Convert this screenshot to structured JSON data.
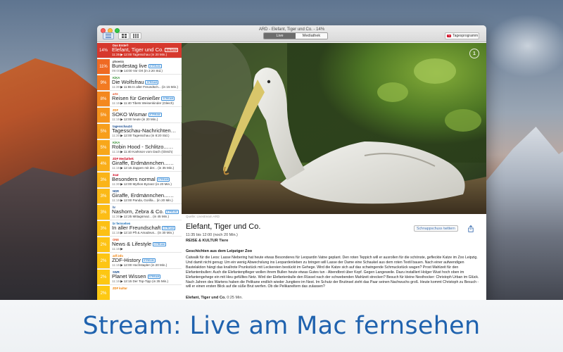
{
  "window": {
    "title": "ARD - Elefant, Tiger und Co. - 14%"
  },
  "toolbar": {
    "segments": [
      "Live",
      "Mediathek"
    ],
    "active_segment": "Live",
    "tv_program_label": "Tagesprogramm",
    "tv_badge": "TV",
    "view_buttons": [
      "list-view-icon",
      "grid-view-icon",
      "grid9-view-icon"
    ]
  },
  "colors": {
    "accent_selected": "#d6382d",
    "stream_badge": "#3c8ed8",
    "banner_text": "#1f62ae"
  },
  "channels": [
    {
      "pct": "14%",
      "pct_color": "#d6382d",
      "logo": "Das Erste®",
      "logo_color": "#ffffff",
      "title": "Elefant, Tiger und Co.",
      "stream": "STREAM",
      "next_time": "11:35",
      "next_prefix": "▶",
      "next": "12:00 Tagesschau (in 20 Min.)",
      "selected": true
    },
    {
      "pct": "11%",
      "pct_color": "#ef6a23",
      "logo": "phoenix",
      "logo_color": "#444444",
      "title": "Bundestag live",
      "stream": "STREAM",
      "next_time": "09:00",
      "next_prefix": "▶",
      "next": "14:00 Vor Ort (in 2:20 Std.)",
      "selected": false
    },
    {
      "pct": "9%",
      "pct_color": "#f27a22",
      "logo": "KiKA",
      "logo_color": "#2e8b2e",
      "title": "Die Wolfsfrau",
      "stream": "STREAM",
      "next_time": "11:30",
      "next_prefix": "▶",
      "next": "11:55 In aller Freundsch... (in 15 Min.)",
      "selected": false
    },
    {
      "pct": "8%",
      "pct_color": "#f4881f",
      "logo": "arte",
      "logo_color": "#e4532a",
      "title": "Reisen für Genießer",
      "stream": "STREAM",
      "next_time": "11:15",
      "next_prefix": "▶",
      "next": "11:40 Tibets Weisenkinder (Gleich)",
      "selected": false
    },
    {
      "pct": "5%",
      "pct_color": "#f6941c",
      "logo": "ZDF",
      "logo_color": "#f07d00",
      "title": "SOKO Wismar",
      "stream": "STREAM",
      "next_time": "11:15",
      "next_prefix": "▶",
      "next": "12:00 heute (in 20 Min.)",
      "selected": false
    },
    {
      "pct": "5%",
      "pct_color": "#f79e1b",
      "logo": "tagesschau24",
      "logo_color": "#1d4f91",
      "title": "Tagesschau-Nachrichten",
      "stream": "STREAM",
      "next_time": "11:30",
      "next_prefix": "▶",
      "next": "12:00 Tagesschau (in 8:20 Std.)",
      "selected": false
    },
    {
      "pct": "5%",
      "pct_color": "#f8a71a",
      "logo": "KiKA",
      "logo_color": "#2e8b2e",
      "title": "Robin Hood - Schlitzo...",
      "stream": "STREAM",
      "next_time": "11:15",
      "next_prefix": "▶",
      "next": "11:40 Karlsson vom Dach (Gleich)",
      "selected": false
    },
    {
      "pct": "4%",
      "pct_color": "#f9ae19",
      "logo": "ZDF Mediathek",
      "logo_color": "#d0021b",
      "title": "Giraffe, Erdmännchen...",
      "stream": "STREAM",
      "next_time": "11:15",
      "next_prefix": "▶",
      "next": "12:15 Zappen mit der... (in 35 Min.)",
      "selected": false
    },
    {
      "pct": "3%",
      "pct_color": "#fab418",
      "logo": "3sat",
      "logo_color": "#d0021b",
      "title": "Besonders normal",
      "stream": "STREAM",
      "next_time": "11:30",
      "next_prefix": "▶",
      "next": "12:00 Mythos Byzanz (in 20 Min.)",
      "selected": false
    },
    {
      "pct": "3%",
      "pct_color": "#fbb917",
      "logo": "NDR",
      "logo_color": "#1d4f91",
      "title": "Giraffe, Erdmännchen...",
      "stream": "STREAM",
      "next_time": "11:15",
      "next_prefix": "▶",
      "next": "12:00 Panda, Gorilla... (in 20 Min.)",
      "selected": false
    },
    {
      "pct": "3%",
      "pct_color": "#fcbd16",
      "logo": "hr",
      "logo_color": "#1d4f91",
      "title": "Nashorn, Zebra & Co.",
      "stream": "STREAM",
      "next_time": "11:30",
      "next_prefix": "▶",
      "next": "12:25 Mittagsmaz... (in 45 Min.)",
      "selected": false
    },
    {
      "pct": "3%",
      "pct_color": "#fcc015",
      "logo": "br fernsehen",
      "logo_color": "#1d6fb5",
      "title": "In aller Freundschaft",
      "stream": "STREAM",
      "next_time": "11:15",
      "next_prefix": "▶",
      "next": "12:10 Pft & Amadeus... (in 30 Min.)",
      "selected": false
    },
    {
      "pct": "2%",
      "pct_color": "#fdc314",
      "logo": "ONE",
      "logo_color": "#e4532a",
      "title": "News & Lifestyle",
      "stream": "STREAM",
      "next_time": "11:15",
      "next_prefix": "▶",
      "next": "",
      "selected": false
    },
    {
      "pct": "2%",
      "pct_color": "#fdc513",
      "logo": "zdf info",
      "logo_color": "#f07d00",
      "title": "ZDF-History",
      "stream": "STREAM",
      "next_time": "11:15",
      "next_prefix": "▶",
      "next": "12:00 Hochstapler (in 20 Min.)",
      "selected": false
    },
    {
      "pct": "2%",
      "pct_color": "#fdc713",
      "logo": "SWR",
      "logo_color": "#1d4f91",
      "title": "Planet Wissen",
      "stream": "STREAM",
      "next_time": "11:15",
      "next_prefix": "▶",
      "next": "12:15 Der Top-Tipp (in 35 Min.)",
      "selected": false
    },
    {
      "pct": "2%",
      "pct_color": "#fdc913",
      "logo": "ZDF kultur",
      "logo_color": "#f07d00",
      "title": "",
      "stream": "",
      "next_time": "",
      "next_prefix": "",
      "next": "",
      "selected": false
    }
  ],
  "video": {
    "logo_text": "1",
    "subject": "pelican"
  },
  "details": {
    "source_label": "Quelle: Livestream ARD",
    "title": "Elefant, Tiger und Co.",
    "time": "11:35 bis 12:00 (noch 20 Min.)",
    "genre": "REISE & KULTUR Tiere",
    "snapshot_btn": "Schnappschuss twittern",
    "description_heading": "Geschichten aus dem Leipziger Zoo",
    "description": "Catwalk für die Leos: Lasse Niebering hat heute etwas Besonderes für Leopardin Vatne geplant. Den roten Teppich will er ausrollen für die schönste, gefleckte Katze im Zoo Leipzig. Und damit nicht genug: Um ein wenig Abwechslung ins Leopardenleben zu bringen will Lasse der Dame eine Schaukel aus dem roten Textil bauen. Nach einer aufwendigen Bastelaktion hängt das knallrote Prunkstück mit Leckereien bestückt im Gehege. Wird die Katze sich auf das schwingende Schmuckstück wagen? Prost Mahlzeit für den Elefantenbullen: Auch die Elefantenpfleger wollen ihrem Bullen heute etwas Gutes tun - Abendbrot über Kopf. Gegen Langeweile. Dazu installiert Holger Wust hoch oben im Elefantengehege ein mit Heu gefülltes Netz. Wird der Elefantenbulle den Rüssel nach der schwebenden Mahlzeit strecken? Besuch für kleine Nesthocker: Christoph Urban im Glück. Nach Jahren des Wartens haben die Pelikane endlich wieder Jungtiere im Nest. Im Schutz der Brutinsel zieht das Paar seinen Nachwuchs groß. Heute kommt Christoph zu Besuch - will er einen ersten Blick auf die süße Brut werfen. Ob die Pelikaneltern das zulassen?",
    "next_show_title": "Elefant, Tiger und Co.",
    "next_show_time": "0:25 Min."
  },
  "banner": {
    "text": "Stream: Live am Mac fernsehen"
  }
}
